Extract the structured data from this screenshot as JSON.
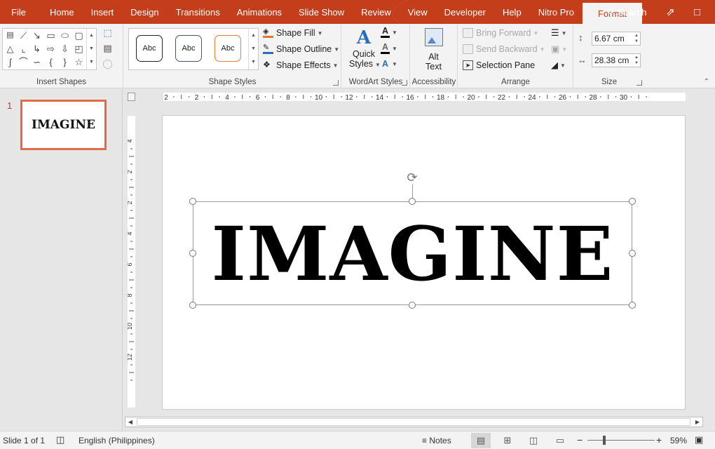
{
  "tabs": [
    "File",
    "Home",
    "Insert",
    "Design",
    "Transitions",
    "Animations",
    "Slide Show",
    "Review",
    "View",
    "Developer",
    "Help",
    "Nitro Pro",
    "Format"
  ],
  "search_label": "Search",
  "ribbon": {
    "insert_shapes_label": "Insert Shapes",
    "shape_styles_label": "Shape Styles",
    "style_samples": [
      "Abc",
      "Abc",
      "Abc"
    ],
    "shape_fill": "Shape Fill",
    "shape_outline": "Shape Outline",
    "shape_effects": "Shape Effects",
    "wordart_label": "WordArt Styles",
    "quick_styles_1": "Quick",
    "quick_styles_2": "Styles",
    "accessibility_label": "Accessibility",
    "alt_text_1": "Alt",
    "alt_text_2": "Text",
    "arrange_label": "Arrange",
    "bring_forward": "Bring Forward",
    "send_backward": "Send Backward",
    "selection_pane": "Selection Pane",
    "size_label": "Size",
    "height_value": "6.67 cm",
    "width_value": "28.38 cm"
  },
  "thumbnail": {
    "number": "1",
    "text": "IMAGINE"
  },
  "slide": {
    "wordart_text": "IMAGINE"
  },
  "ruler": {
    "h_labels": [
      "2",
      "2",
      "4",
      "6",
      "8",
      "10",
      "12",
      "14",
      "16",
      "18",
      "20",
      "22",
      "24",
      "26",
      "28",
      "30"
    ],
    "v_labels": [
      "4",
      "2",
      "2",
      "4",
      "6",
      "8",
      "10",
      "12"
    ]
  },
  "status": {
    "slide_info": "Slide 1 of 1",
    "language": "English (Philippines)",
    "notes": "Notes",
    "zoom": "59%"
  },
  "colors": {
    "accent": "#c43e1c",
    "selected_thumb_border": "#e26a48"
  }
}
